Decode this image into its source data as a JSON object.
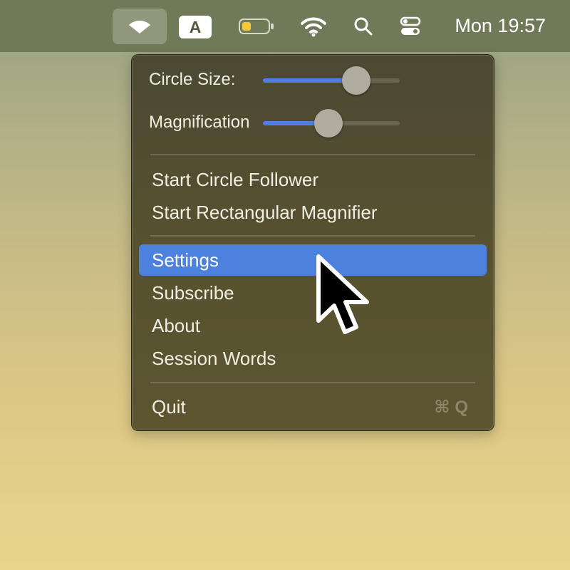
{
  "menubar": {
    "active_app_icon": "wifi-eye-icon",
    "input_source_letter": "A",
    "battery_color": "#f5c83c",
    "icons": [
      "wifi-icon",
      "search-icon",
      "control-center-icon"
    ],
    "clock": "Mon 19:57"
  },
  "menu": {
    "sliders": [
      {
        "label": "Circle Size:",
        "value": 0.68
      },
      {
        "label": "Magnification",
        "value": 0.48
      }
    ],
    "items": [
      {
        "label": "Start Circle Follower"
      },
      {
        "label": "Start Rectangular Magnifier"
      },
      {
        "label": "Settings",
        "highlighted": true
      },
      {
        "label": "Subscribe"
      },
      {
        "label": "About"
      },
      {
        "label": "Session Words"
      },
      {
        "label": "Quit",
        "shortcut": "⌘ Q"
      }
    ]
  },
  "colors": {
    "highlight": "#4c82dd",
    "slider_fill": "#4f7fe0"
  }
}
